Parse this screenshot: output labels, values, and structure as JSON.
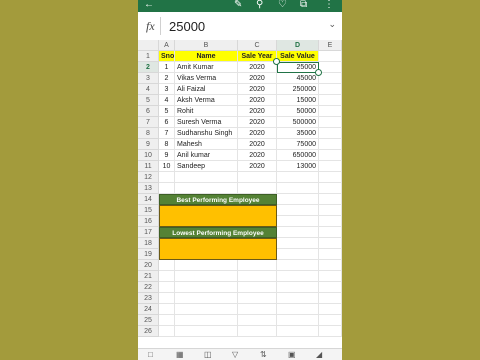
{
  "formula_bar": {
    "fx_label": "fx",
    "value": "25000"
  },
  "columns": [
    "A",
    "B",
    "C",
    "D",
    "E"
  ],
  "rows": [
    "1",
    "2",
    "3",
    "4",
    "5",
    "6",
    "7",
    "8",
    "9",
    "10",
    "11",
    "12",
    "13",
    "14",
    "15",
    "16",
    "17",
    "18",
    "19",
    "20",
    "21",
    "22",
    "23",
    "24",
    "25",
    "26"
  ],
  "table": {
    "headers": [
      "Sno",
      "Name",
      "Sale Year",
      "Sale Value"
    ],
    "data": [
      [
        "1",
        "Amit Kumar",
        "2020",
        "25000"
      ],
      [
        "2",
        "Vikas Verma",
        "2020",
        "45000"
      ],
      [
        "3",
        "Ali Faizal",
        "2020",
        "250000"
      ],
      [
        "4",
        "Aksh Verma",
        "2020",
        "15000"
      ],
      [
        "5",
        "Rohit",
        "2020",
        "50000"
      ],
      [
        "6",
        "Suresh Verma",
        "2020",
        "500000"
      ],
      [
        "7",
        "Sudhanshu Singh",
        "2020",
        "35000"
      ],
      [
        "8",
        "Mahesh",
        "2020",
        "75000"
      ],
      [
        "9",
        "Anil kumar",
        "2020",
        "650000"
      ],
      [
        "10",
        "Sandeep",
        "2020",
        "13000"
      ]
    ]
  },
  "best_label": "Best Performing Employee",
  "lowest_label": "Lowest Performing Employee",
  "selected_cell": "D2",
  "icons": {
    "back": "back-arrow-icon",
    "pen": "pen-icon",
    "search": "search-icon",
    "ideas": "lightbulb-icon",
    "share": "share-icon",
    "more": "more-icon"
  },
  "colors": {
    "app_green": "#217346",
    "header_yellow": "#ffff00",
    "label_green": "#548235",
    "fill_gold": "#ffc000",
    "background": "#a39b3c"
  }
}
